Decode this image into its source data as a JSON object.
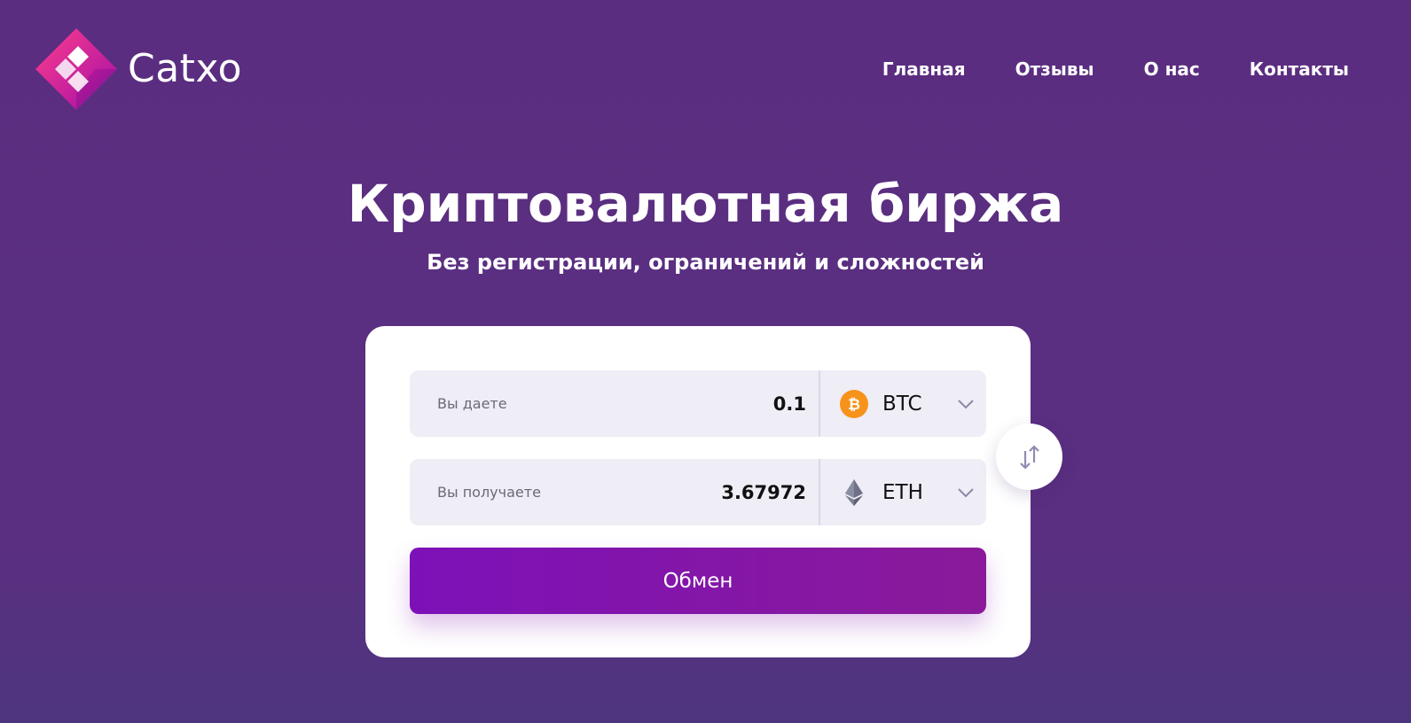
{
  "brand": {
    "name": "Catxo"
  },
  "nav": {
    "items": [
      {
        "label": "Главная"
      },
      {
        "label": "Отзывы"
      },
      {
        "label": "О нас"
      },
      {
        "label": "Контакты"
      }
    ]
  },
  "hero": {
    "title": "Криптовалютная биржа",
    "subtitle": "Без регистрации, ограничений и сложностей"
  },
  "exchange": {
    "give": {
      "label": "Вы даете",
      "amount": "0.1",
      "currency": "BTC",
      "icon": "bitcoin-icon"
    },
    "get": {
      "label": "Вы получаете",
      "amount": "3.67972",
      "currency": "ETH",
      "icon": "ethereum-icon"
    },
    "swap_icon": "swap-arrows-icon",
    "button_label": "Обмен"
  },
  "colors": {
    "background": "#5b2d80",
    "card": "#ffffff",
    "field": "#efedf5",
    "button_start": "#7d11b8",
    "button_end": "#8a1a99",
    "bitcoin": "#f7931a",
    "ethereum": "#5c5f73"
  }
}
